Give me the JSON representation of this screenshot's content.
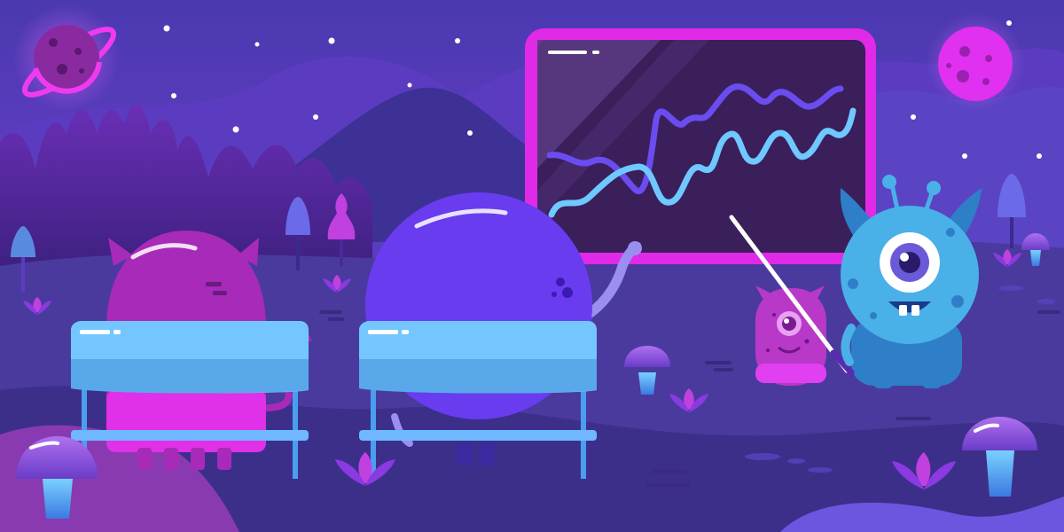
{
  "scene": {
    "palette": {
      "sky_top": "#4a3db8",
      "sky_mid": "#7a3fd0",
      "ground": "#4a3a9e",
      "board_frame": "#e02ae8",
      "board_screen": "#3a1f5a",
      "line_primary": "#6a4cf0",
      "line_secondary": "#6fc8ff",
      "desk_top": "#74c6ff",
      "blue_monster": "#4ab0e8",
      "pink_monster": "#a82ab8",
      "purple_monster": "#6a3cf0",
      "small_monster": "#b838c8",
      "planet_pink": "#e030f0"
    },
    "icons": [
      "ringed-planet-icon",
      "moon-icon",
      "chalkboard-icon",
      "alien-teacher-icon",
      "alien-student-icon",
      "mushroom-icon",
      "plant-sprout-icon"
    ]
  }
}
